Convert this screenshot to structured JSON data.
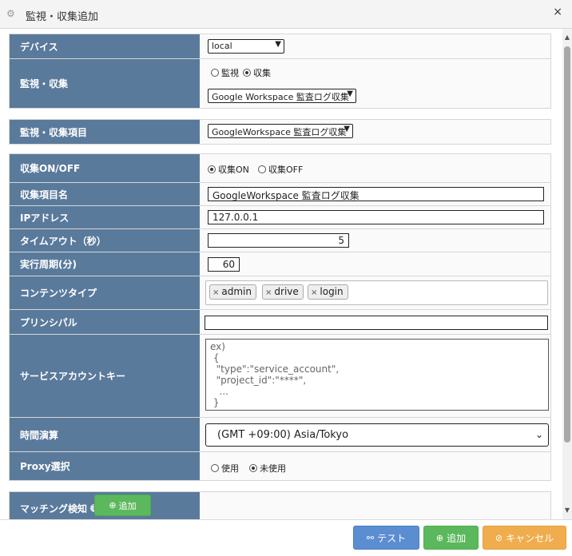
{
  "window": {
    "title": "監視・収集追加",
    "close_label": "×"
  },
  "section_device": {
    "device_label": "デバイス",
    "device_value": "local",
    "type_label": "監視・収集",
    "radio_monitor": "監視",
    "radio_collect": "収集",
    "selected_type": "収集",
    "collector_value": "Google Workspace 監査ログ収集"
  },
  "section_item": {
    "item_label": "監視・収集項目",
    "item_value": "GoogleWorkspace 監査ログ収集"
  },
  "section_settings": {
    "onoff_label": "収集ON/OFF",
    "on_label": "収集ON",
    "off_label": "収集OFF",
    "onoff_selected": "収集ON",
    "name_label": "収集項目名",
    "name_value": "GoogleWorkspace 監査ログ収集",
    "ip_label": "IPアドレス",
    "ip_value": "127.0.0.1",
    "timeout_label": "タイムアウト（秒）",
    "timeout_value": "5",
    "interval_label": "実行周期(分)",
    "interval_value": "60",
    "content_type_label": "コンテンツタイプ",
    "content_types": [
      "admin",
      "drive",
      "login"
    ],
    "principal_label": "プリンシパル",
    "principal_value": "",
    "service_key_label": "サービスアカウントキー",
    "service_key_placeholder": "ex)\n {\n  \"type\":\"service_account\",\n  \"project_id\":\"****\",\n   ...\n }",
    "timezone_label": "時間演算",
    "timezone_value": "(GMT +09:00) Asia/Tokyo",
    "proxy_label": "Proxy選択",
    "proxy_use": "使用",
    "proxy_unused": "未使用",
    "proxy_selected": "未使用"
  },
  "section_matching": {
    "matching_label": "マッチング検知",
    "add_label": "追加"
  },
  "footer": {
    "test_label": "テスト",
    "add_label": "追加",
    "cancel_label": "キャンセル"
  },
  "colors": {
    "label_bg": "#5a7a9c",
    "btn_test": "#5b8ed1",
    "btn_add": "#5cb85c",
    "btn_cancel": "#f0ad4e"
  }
}
